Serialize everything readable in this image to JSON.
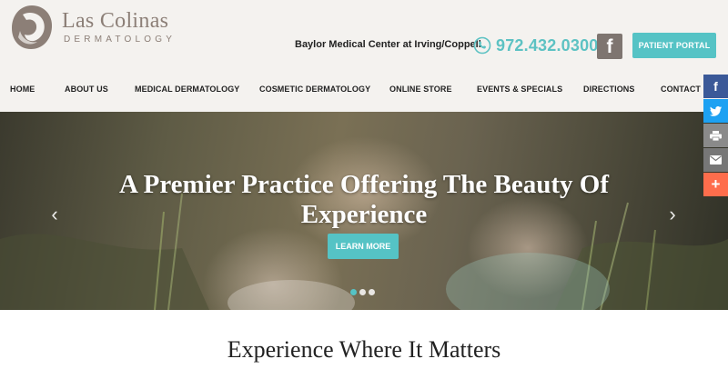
{
  "brand": {
    "name": "Las Colinas",
    "sub": "DERMATOLOGY"
  },
  "header": {
    "location": "Baylor Medical Center at Irving/Coppell",
    "phone": "972.432.0300",
    "facebook_label": "f",
    "portal_label": "PATIENT PORTAL"
  },
  "nav": {
    "items": [
      {
        "label": "HOME"
      },
      {
        "label": "ABOUT US"
      },
      {
        "label": "MEDICAL DERMATOLOGY"
      },
      {
        "label": "COSMETIC DERMATOLOGY"
      },
      {
        "label": "ONLINE STORE"
      },
      {
        "label": "EVENTS & SPECIALS"
      },
      {
        "label": "DIRECTIONS"
      },
      {
        "label": "CONTACT US"
      }
    ]
  },
  "hero": {
    "title": "A Premier Practice Offering The Beauty Of Experience",
    "button": "LEARN MORE",
    "prev_icon": "chevron-left-icon",
    "next_icon": "chevron-right-icon",
    "slides": 3,
    "active_slide": 1
  },
  "share": {
    "items": [
      {
        "icon": "facebook-icon",
        "color": "#3b5998"
      },
      {
        "icon": "twitter-icon",
        "color": "#1da1f2"
      },
      {
        "icon": "print-icon",
        "color": "#8a8a8a"
      },
      {
        "icon": "email-icon",
        "color": "#777777"
      },
      {
        "icon": "plus-icon",
        "color": "#fe6d4c"
      }
    ]
  },
  "section": {
    "title": "Experience Where It Matters"
  },
  "colors": {
    "accent": "#55c3c5",
    "brand": "#8c7f77",
    "header_bg": "#f4f2ef"
  }
}
